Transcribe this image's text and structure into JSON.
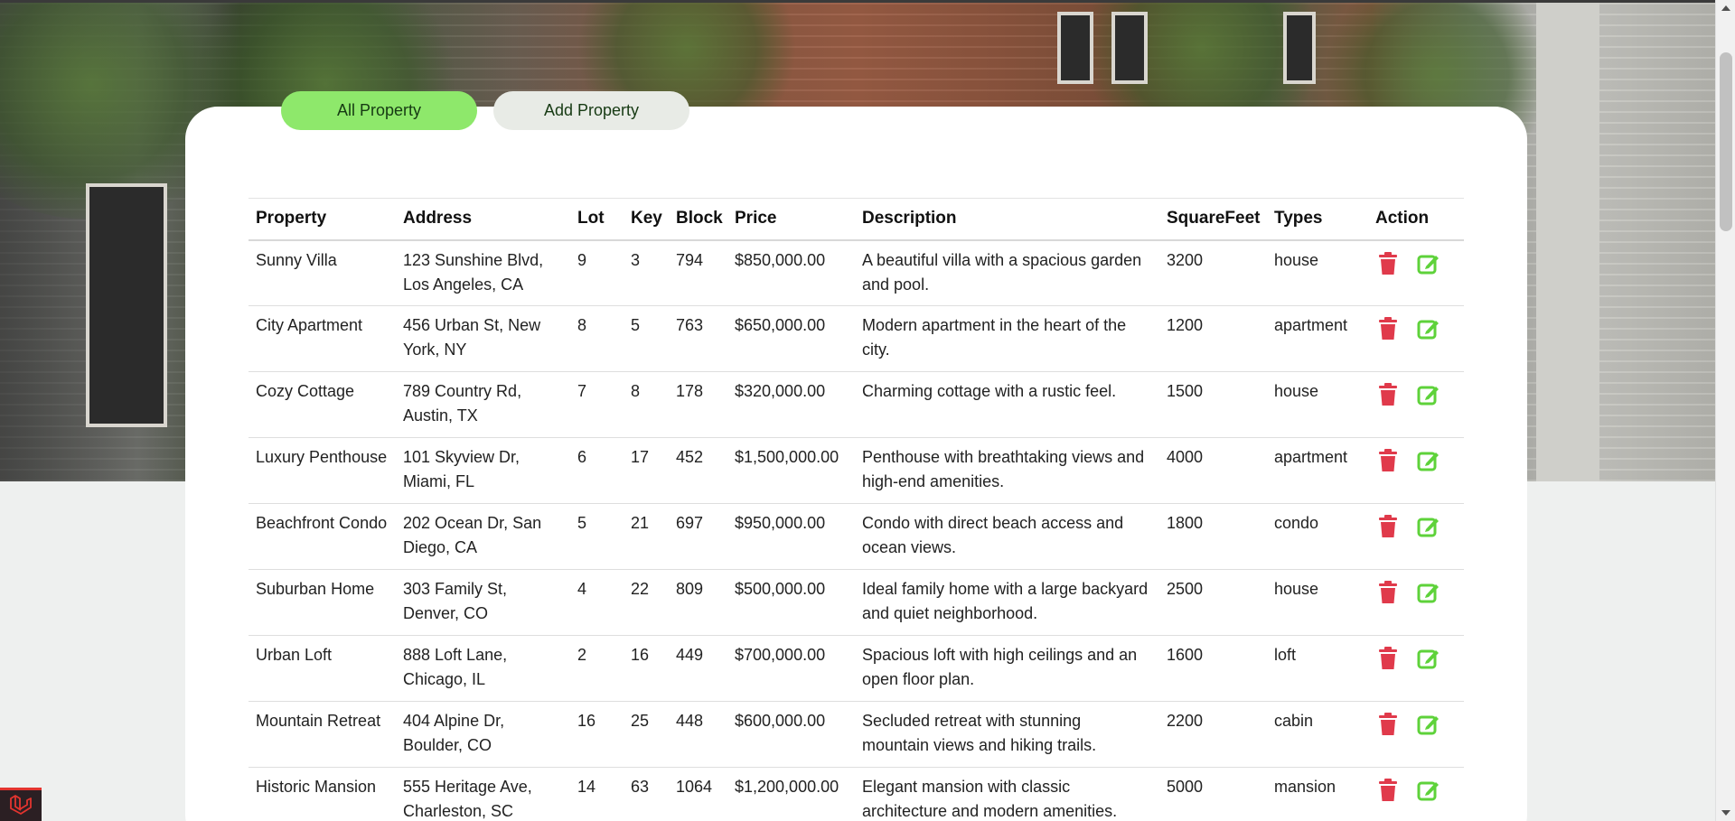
{
  "tabs": {
    "all_label": "All Property",
    "add_label": "Add Property"
  },
  "colors": {
    "accent_green": "#8ee86b",
    "delete_red": "#e03a4b",
    "edit_green": "#5ed23a"
  },
  "table": {
    "headers": [
      "Property",
      "Address",
      "Lot",
      "Key",
      "Block",
      "Price",
      "Description",
      "SquareFeet",
      "Types",
      "Action"
    ],
    "rows": [
      {
        "property": "Sunny Villa",
        "address": "123 Sunshine Blvd, Los Angeles, CA",
        "lot": "9",
        "key": "3",
        "block": "794",
        "price": "$850,000.00",
        "description": "A beautiful villa with a spacious garden and pool.",
        "sqft": "3200",
        "type": "house"
      },
      {
        "property": "City Apartment",
        "address": "456 Urban St, New York, NY",
        "lot": "8",
        "key": "5",
        "block": "763",
        "price": "$650,000.00",
        "description": "Modern apartment in the heart of the city.",
        "sqft": "1200",
        "type": "apartment"
      },
      {
        "property": "Cozy Cottage",
        "address": "789 Country Rd, Austin, TX",
        "lot": "7",
        "key": "8",
        "block": "178",
        "price": "$320,000.00",
        "description": "Charming cottage with a rustic feel.",
        "sqft": "1500",
        "type": "house"
      },
      {
        "property": "Luxury Penthouse",
        "address": "101 Skyview Dr, Miami, FL",
        "lot": "6",
        "key": "17",
        "block": "452",
        "price": "$1,500,000.00",
        "description": "Penthouse with breathtaking views and high-end amenities.",
        "sqft": "4000",
        "type": "apartment"
      },
      {
        "property": "Beachfront Condo",
        "address": "202 Ocean Dr, San Diego, CA",
        "lot": "5",
        "key": "21",
        "block": "697",
        "price": "$950,000.00",
        "description": "Condo with direct beach access and ocean views.",
        "sqft": "1800",
        "type": "condo"
      },
      {
        "property": "Suburban Home",
        "address": "303 Family St, Denver, CO",
        "lot": "4",
        "key": "22",
        "block": "809",
        "price": "$500,000.00",
        "description": "Ideal family home with a large backyard and quiet neighborhood.",
        "sqft": "2500",
        "type": "house"
      },
      {
        "property": "Urban Loft",
        "address": "888 Loft Lane, Chicago, IL",
        "lot": "2",
        "key": "16",
        "block": "449",
        "price": "$700,000.00",
        "description": "Spacious loft with high ceilings and an open floor plan.",
        "sqft": "1600",
        "type": "loft"
      },
      {
        "property": "Mountain Retreat",
        "address": "404 Alpine Dr, Boulder, CO",
        "lot": "16",
        "key": "25",
        "block": "448",
        "price": "$600,000.00",
        "description": "Secluded retreat with stunning mountain views and hiking trails.",
        "sqft": "2200",
        "type": "cabin"
      },
      {
        "property": "Historic Mansion",
        "address": "555 Heritage Ave, Charleston, SC",
        "lot": "14",
        "key": "63",
        "block": "1064",
        "price": "$1,200,000.00",
        "description": "Elegant mansion with classic architecture and modern amenities.",
        "sqft": "5000",
        "type": "mansion"
      }
    ]
  },
  "icons": {
    "delete": "trash-icon",
    "edit": "edit-icon",
    "corner": "laravel-logo-icon"
  }
}
